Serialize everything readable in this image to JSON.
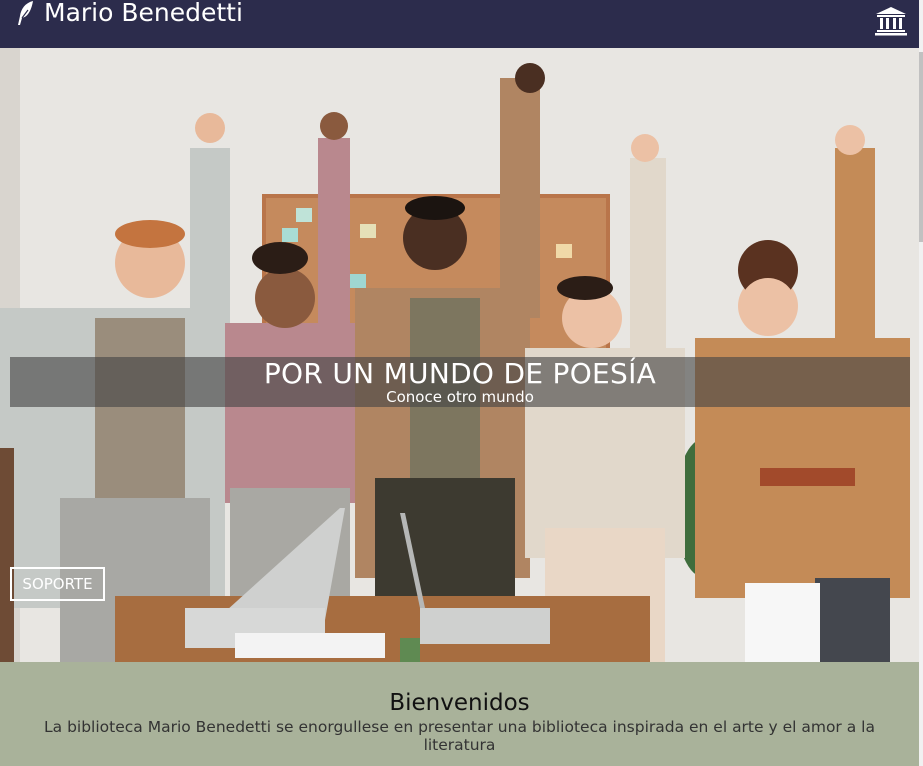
{
  "navbar": {
    "brand": "Mario Benedetti",
    "brand_icon": "feather-icon",
    "library_icon": "landmark-icon",
    "background": "#2c2c4c"
  },
  "hero": {
    "title": "POR UN MUNDO DE POESÍA",
    "subtitle": "Conoce otro mundo",
    "support_button": "SOPORTE"
  },
  "welcome": {
    "title": "Bienvenidos",
    "text": "La biblioteca Mario Benedetti se enorgullese en presentar una biblioteca inspirada en el arte y el amor a la literatura",
    "background": "#a9b29a"
  }
}
